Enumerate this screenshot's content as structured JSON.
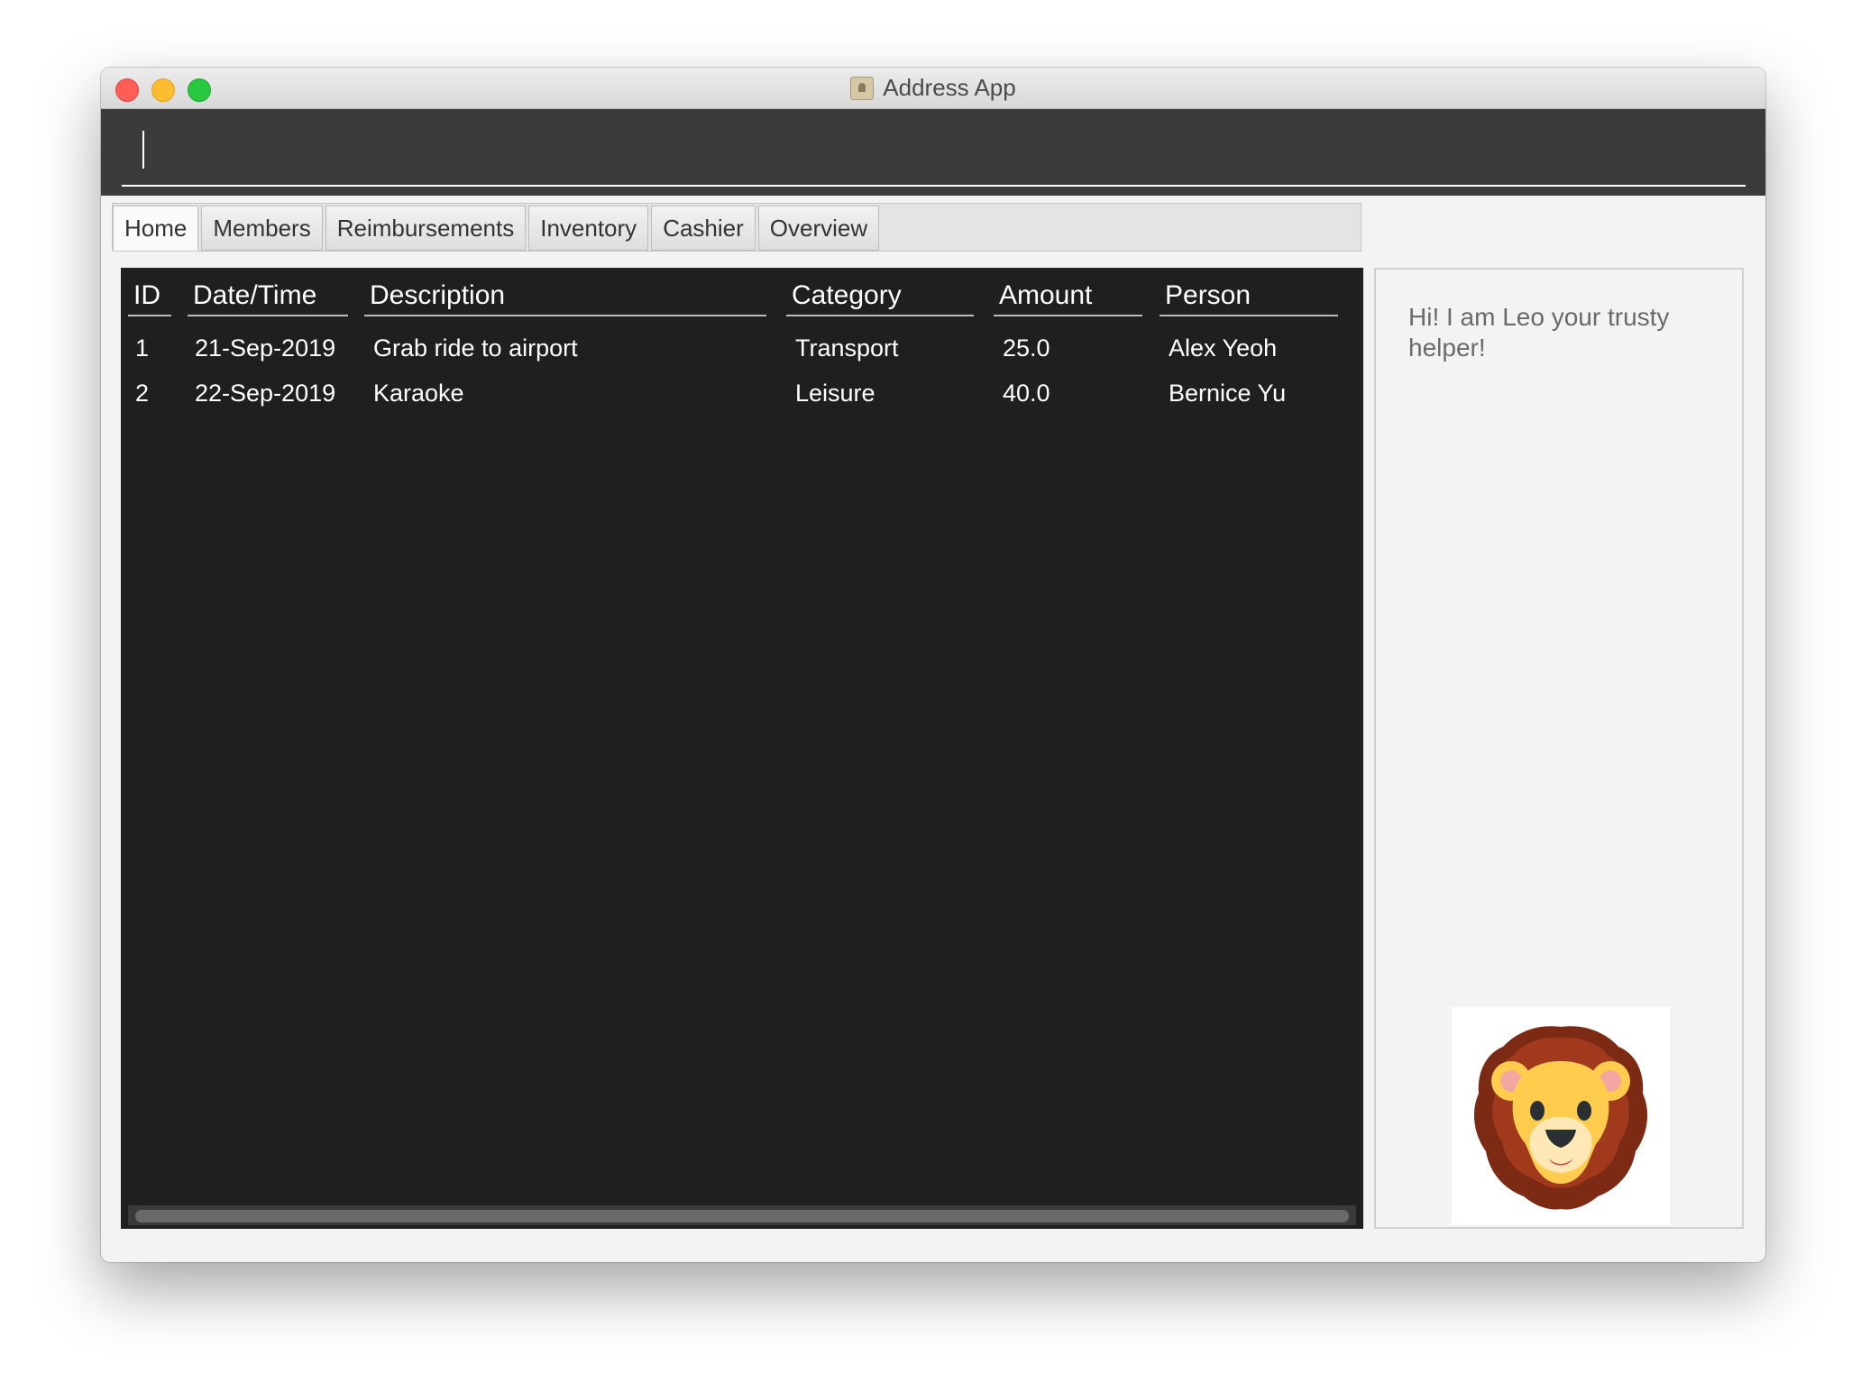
{
  "window": {
    "title": "Address App"
  },
  "command_box": {
    "value": "",
    "placeholder": ""
  },
  "tabs": [
    {
      "label": "Home",
      "active": true
    },
    {
      "label": "Members",
      "active": false
    },
    {
      "label": "Reimbursements",
      "active": false
    },
    {
      "label": "Inventory",
      "active": false
    },
    {
      "label": "Cashier",
      "active": false
    },
    {
      "label": "Overview",
      "active": false
    }
  ],
  "table": {
    "columns": [
      "ID",
      "Date/Time",
      "Description",
      "Category",
      "Amount",
      "Person"
    ],
    "rows": [
      [
        "1",
        "21-Sep-2019",
        "Grab ride to airport",
        "Transport",
        "25.0",
        "Alex Yeoh"
      ],
      [
        "2",
        "22-Sep-2019",
        "Karaoke",
        "Leisure",
        "40.0",
        "Bernice Yu"
      ]
    ]
  },
  "helper": {
    "message": "Hi! I am Leo your trusty helper!",
    "avatar_icon": "lion-icon"
  },
  "colors": {
    "command_bar": "#3b3b3b",
    "table_background": "#1f1f1f",
    "traffic_close": "#fd5f57",
    "traffic_minimize": "#febc2e",
    "traffic_maximize": "#28c840"
  }
}
